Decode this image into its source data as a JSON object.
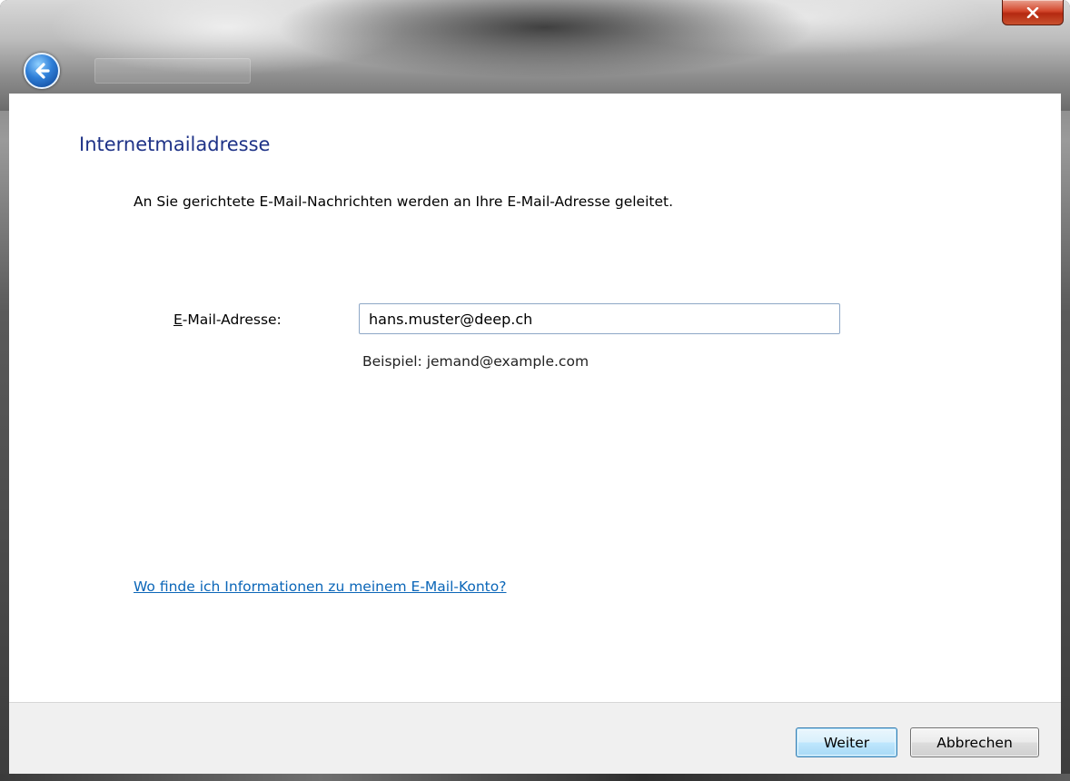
{
  "window": {
    "close_symbol": "x"
  },
  "navigation": {
    "back_icon": "back-arrow-icon"
  },
  "main": {
    "title": "Internetmailadresse",
    "description": "An Sie gerichtete E-Mail-Nachrichten werden an Ihre E-Mail-Adresse geleitet.",
    "email_label_mnemonic": "E",
    "email_label_rest": "-Mail-Adresse:",
    "email_value": "hans.muster@deep.ch",
    "email_example": "Beispiel: jemand@example.com",
    "help_link": "Wo finde ich Informationen zu meinem E-Mail-Konto?"
  },
  "footer": {
    "next_label": "Weiter",
    "cancel_label": "Abbrechen"
  },
  "colors": {
    "title": "#1e3287",
    "link": "#0b66b8",
    "close_button": "#c9381c"
  }
}
